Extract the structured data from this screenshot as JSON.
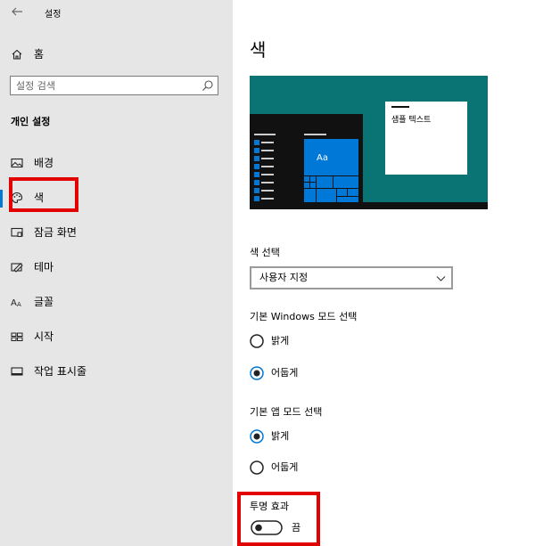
{
  "window": {
    "title": "설정"
  },
  "sidebar": {
    "home_label": "홈",
    "search_placeholder": "설정 검색",
    "section_title": "개인 설정",
    "items": [
      {
        "label": "배경",
        "icon": "picture-icon"
      },
      {
        "label": "색",
        "icon": "palette-icon"
      },
      {
        "label": "잠금 화면",
        "icon": "lock-screen-icon"
      },
      {
        "label": "테마",
        "icon": "theme-icon"
      },
      {
        "label": "글꼴",
        "icon": "font-icon"
      },
      {
        "label": "시작",
        "icon": "start-icon"
      },
      {
        "label": "작업 표시줄",
        "icon": "taskbar-icon"
      }
    ],
    "selected_item": "색",
    "highlight_color": "#e30000"
  },
  "main": {
    "title": "색",
    "preview": {
      "sample_text": "샘플 텍스트",
      "tile_text": "Aa",
      "background_color": "#0a7373",
      "accent_color": "#0078d7"
    },
    "color_choice": {
      "label": "색 선택",
      "value": "사용자 지정"
    },
    "windows_mode": {
      "label": "기본 Windows 모드 선택",
      "options": [
        "밝게",
        "어둡게"
      ],
      "selected": "어둡게"
    },
    "app_mode": {
      "label": "기본 앱 모드 선택",
      "options": [
        "밝게",
        "어둡게"
      ],
      "selected": "밝게"
    },
    "transparency": {
      "label": "투명 효과",
      "state_label": "끔",
      "enabled": false
    }
  }
}
